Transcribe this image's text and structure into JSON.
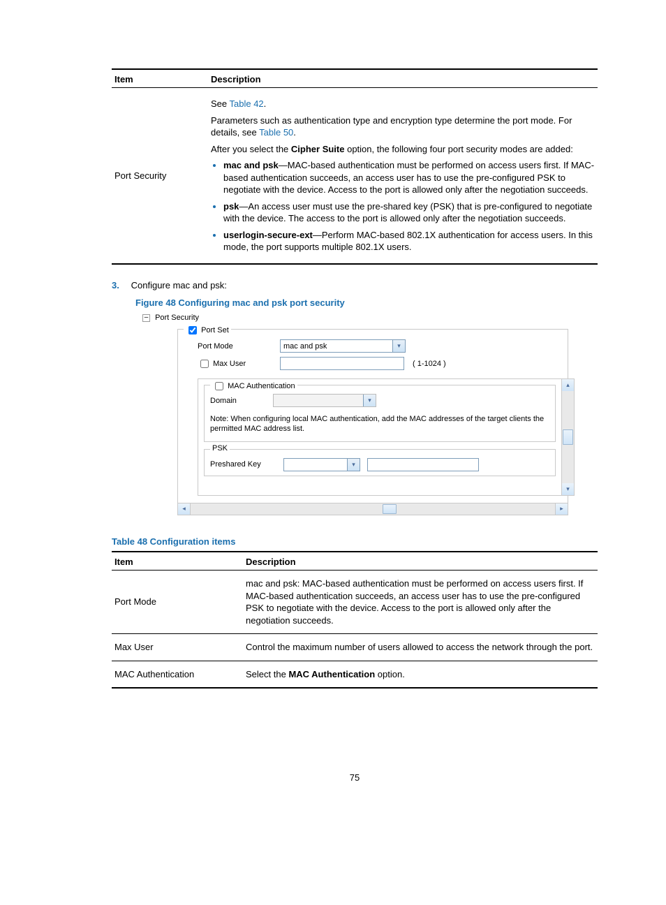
{
  "table1": {
    "head_item": "Item",
    "head_desc": "Description",
    "row_item": "Port Security",
    "see": "See ",
    "link1": "Table 42",
    "period": ".",
    "p1a": "Parameters such as authentication type and encryption type determine the port mode. For details, see ",
    "link2": "Table 50",
    "p2_pre": "After you select the ",
    "p2_bold": "Cipher Suite",
    "p2_post": " option, the following four port security modes are added:",
    "b1_bold": "mac and psk",
    "b1_text": "—MAC-based authentication must be performed on access users first. If MAC-based authentication succeeds, an access user has to use the pre-configured PSK to negotiate with the device. Access to the port is allowed only after the negotiation succeeds.",
    "b2_bold": "psk",
    "b2_text": "—An access user must use the pre-shared key (PSK) that is pre-configured to negotiate with the device. The access to the port is allowed only after the negotiation succeeds.",
    "b3_bold": "userlogin-secure-ext",
    "b3_text": "—Perform MAC-based 802.1X authentication for access users. In this mode, the port supports multiple 802.1X users."
  },
  "step": {
    "num": "3.",
    "text": "Configure mac and psk:"
  },
  "fig_caption": "Figure 48 Configuring mac and psk port security",
  "figure": {
    "tree": "Port Security",
    "minus": "–",
    "portset_legend_lab": "Port Set",
    "portmode_label": "Port Mode",
    "portmode_value": "mac and psk",
    "maxuser_label": "Max User",
    "maxuser_range": "( 1-1024 )",
    "macauth_legend": "MAC Authentication",
    "domain_label": "Domain",
    "note": "Note: When configuring local MAC authentication, add the MAC addresses of the target clients the permitted MAC address list.",
    "psk_legend": "PSK",
    "preshared_label": "Preshared Key",
    "arrow_down": "▾",
    "arrow_up": "▴",
    "arrow_left": "◂",
    "arrow_right": "▸"
  },
  "tbl_caption": "Table 48 Configuration items",
  "table2": {
    "head_item": "Item",
    "head_desc": "Description",
    "r1_item": "Port Mode",
    "r1_desc": "mac and psk: MAC-based authentication must be performed on access users first. If MAC-based authentication succeeds, an access user has to use the pre-configured PSK to negotiate with the device. Access to the port is allowed only after the negotiation succeeds.",
    "r2_item": "Max User",
    "r2_desc": "Control the maximum number of users allowed to access the network through the port.",
    "r3_item": "MAC Authentication",
    "r3_pre": "Select the ",
    "r3_bold": "MAC Authentication",
    "r3_post": " option."
  },
  "pagenum": "75"
}
